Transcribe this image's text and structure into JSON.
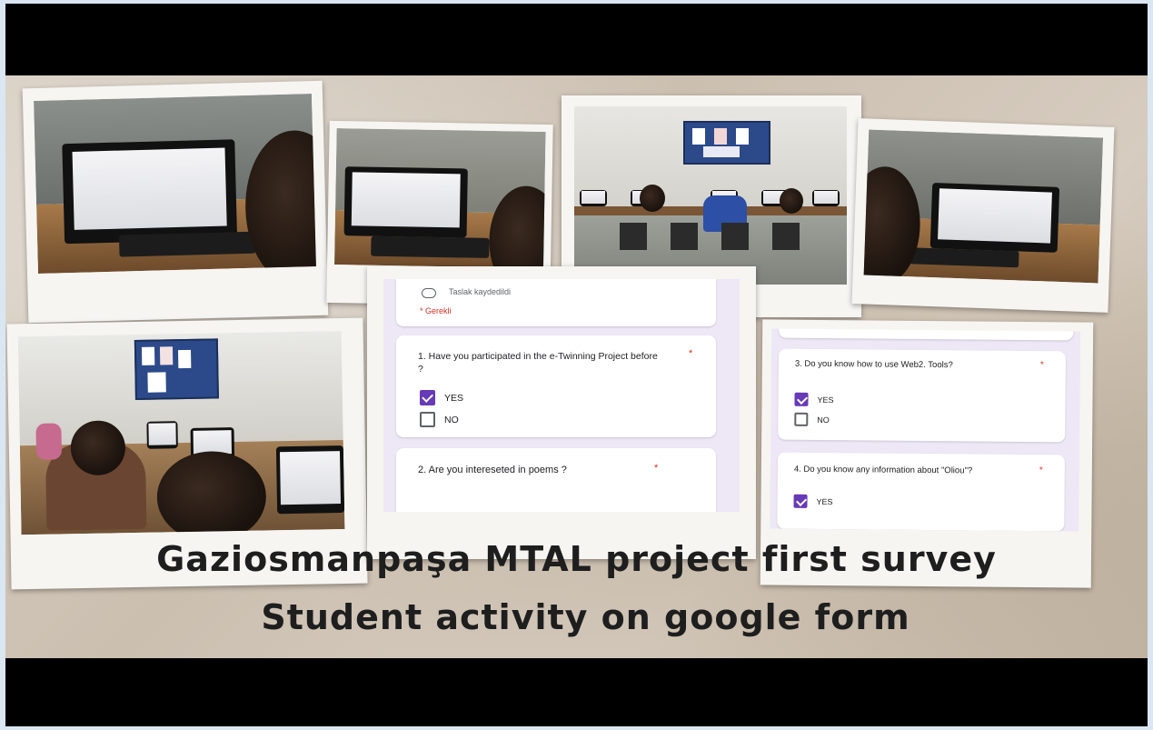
{
  "caption": {
    "line1": "Gaziosmanpaşa MTAL project  first survey",
    "line2": "Student activity on google form"
  },
  "form_left": {
    "saved_status": "Taslak kaydedildi",
    "required_note": "* Gerekli",
    "question1": "1. Have you participated in the e-Twinning Project before ?",
    "q1_option_yes": "YES",
    "q1_option_no": "NO",
    "question2": "2. Are you intereseted in poems ?",
    "required_star": "*"
  },
  "form_right": {
    "question3": "3.    Do you know how to use Web2. Tools?",
    "q3_option_yes": "YES",
    "q3_option_no": "NO",
    "question4": "4.  Do you know any information about \"Oliou\"?",
    "q4_option_yes": "YES",
    "required_star": "*"
  },
  "colors": {
    "form_accent": "#673ab7",
    "form_background": "#ede7f6",
    "letterbox": "#000000"
  }
}
